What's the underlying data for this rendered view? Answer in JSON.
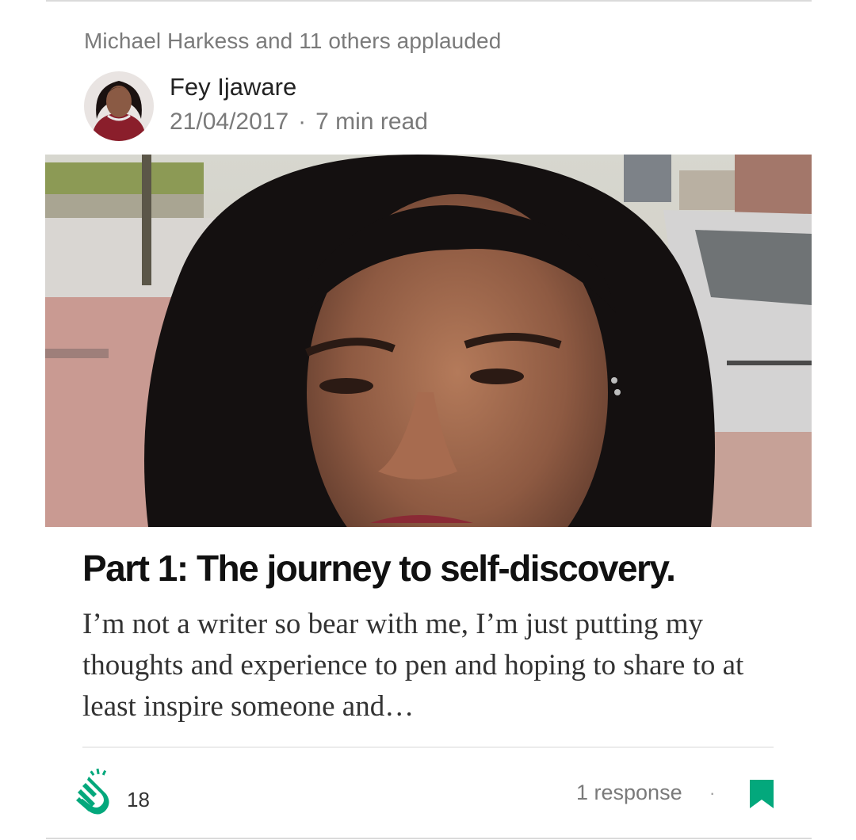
{
  "social": {
    "applauded_text": "Michael Harkess and 11 others applauded"
  },
  "author": {
    "name": "Fey Ijaware",
    "date": "21/04/2017",
    "separator": "·",
    "read_time": "7 min read"
  },
  "article": {
    "title": "Part 1: The journey to self-discovery.",
    "excerpt": "I’m not a writer so bear with me, I’m just putting my thoughts and experience to pen and hoping to share to at least inspire someone and…"
  },
  "footer": {
    "clap_count": "18",
    "responses_label": "1 response",
    "separator": "·"
  },
  "icons": {
    "clap": "clap-icon",
    "bookmark": "bookmark-icon"
  },
  "colors": {
    "accent_green": "#03a87c",
    "muted_text": "#7a7a7a"
  }
}
